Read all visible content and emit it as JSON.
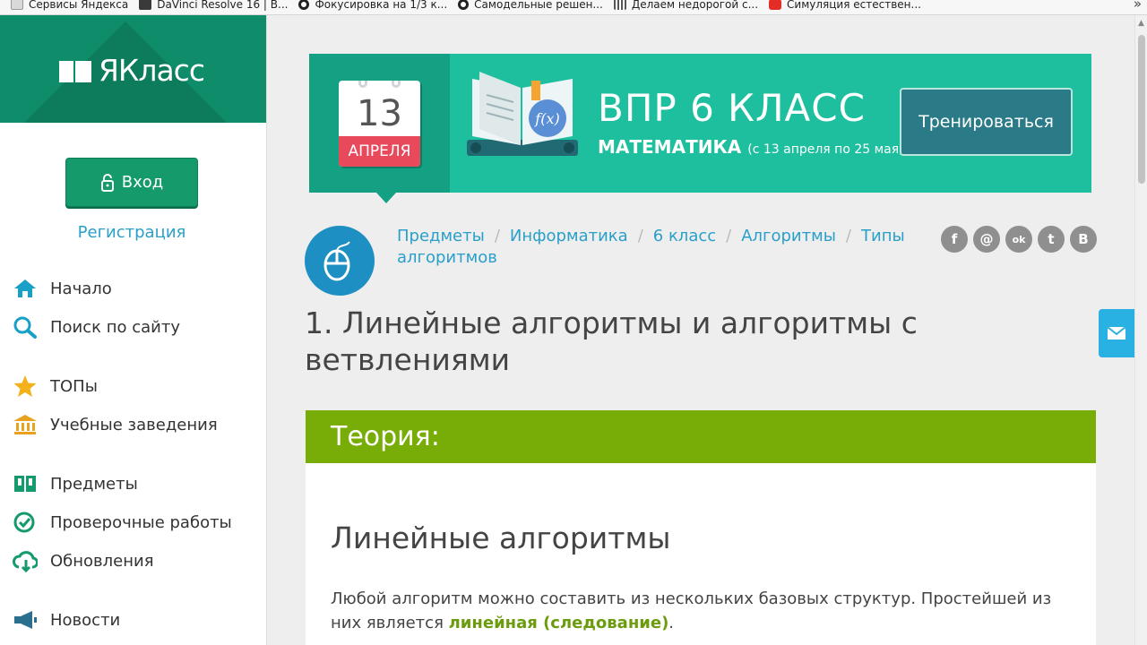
{
  "bookmarks": [
    {
      "label": "Сервисы Яндекса",
      "color": "#cccccc"
    },
    {
      "label": "DaVinci Resolve 16 | В...",
      "color": "#3a3a3a"
    },
    {
      "label": "Фокусировка на 1/3 к...",
      "color": "#222222"
    },
    {
      "label": "Самодельные решен...",
      "color": "#222222"
    },
    {
      "label": "Делаем недорогой с...",
      "color": "#555555"
    },
    {
      "label": "Симуляция естествен...",
      "color": "#e52d27"
    }
  ],
  "bookmarks_more": "»",
  "sidebar": {
    "logo_text": "ЯКласс",
    "login_label": "Вход",
    "register_label": "Регистрация",
    "nav": [
      {
        "label": "Начало",
        "icon": "home-icon"
      },
      {
        "label": "Поиск по сайту",
        "icon": "search-icon"
      },
      {
        "label": "ТОПы",
        "icon": "star-icon"
      },
      {
        "label": "Учебные заведения",
        "icon": "institution-icon"
      },
      {
        "label": "Предметы",
        "icon": "books-icon"
      },
      {
        "label": "Проверочные работы",
        "icon": "check-icon"
      },
      {
        "label": "Обновления",
        "icon": "cloud-update-icon"
      },
      {
        "label": "Новости",
        "icon": "megaphone-icon"
      }
    ]
  },
  "banner": {
    "cal_day": "13",
    "cal_month": "АПРЕЛЯ",
    "book_formula": "f(x)",
    "title": "ВПР 6 КЛАСС",
    "subject": "МАТЕМАТИКА",
    "dates": "(с 13 апреля по 25 мая)",
    "button_label": "Тренироваться"
  },
  "breadcrumbs": [
    {
      "label": "Предметы"
    },
    {
      "label": "Информатика"
    },
    {
      "label": "6 класс"
    },
    {
      "label": "Алгоритмы"
    },
    {
      "label": "Типы алгоритмов"
    }
  ],
  "breadcrumb_sep": "/",
  "socials": [
    {
      "glyph": "f",
      "icon": "facebook-icon"
    },
    {
      "glyph": "@",
      "icon": "mail-ru-icon"
    },
    {
      "glyph": "ok",
      "icon": "odnoklassniki-icon"
    },
    {
      "glyph": "t",
      "icon": "twitter-icon"
    },
    {
      "glyph": "В",
      "icon": "vk-icon"
    }
  ],
  "page_title": "1. Линейные алгоритмы и алгоритмы с ветвлениями",
  "theory_label": "Теория:",
  "content": {
    "heading": "Линейные алгоритмы",
    "para_before": "Любой алгоритм можно составить из нескольких базовых структур. Простейшей из них является ",
    "para_highlight": "линейная (следование)",
    "para_after": "."
  },
  "colors": {
    "brand_green": "#0f8d6a",
    "banner_teal": "#1dbf9e",
    "theory_green": "#78ad07",
    "link_blue": "#2a9fc9"
  }
}
